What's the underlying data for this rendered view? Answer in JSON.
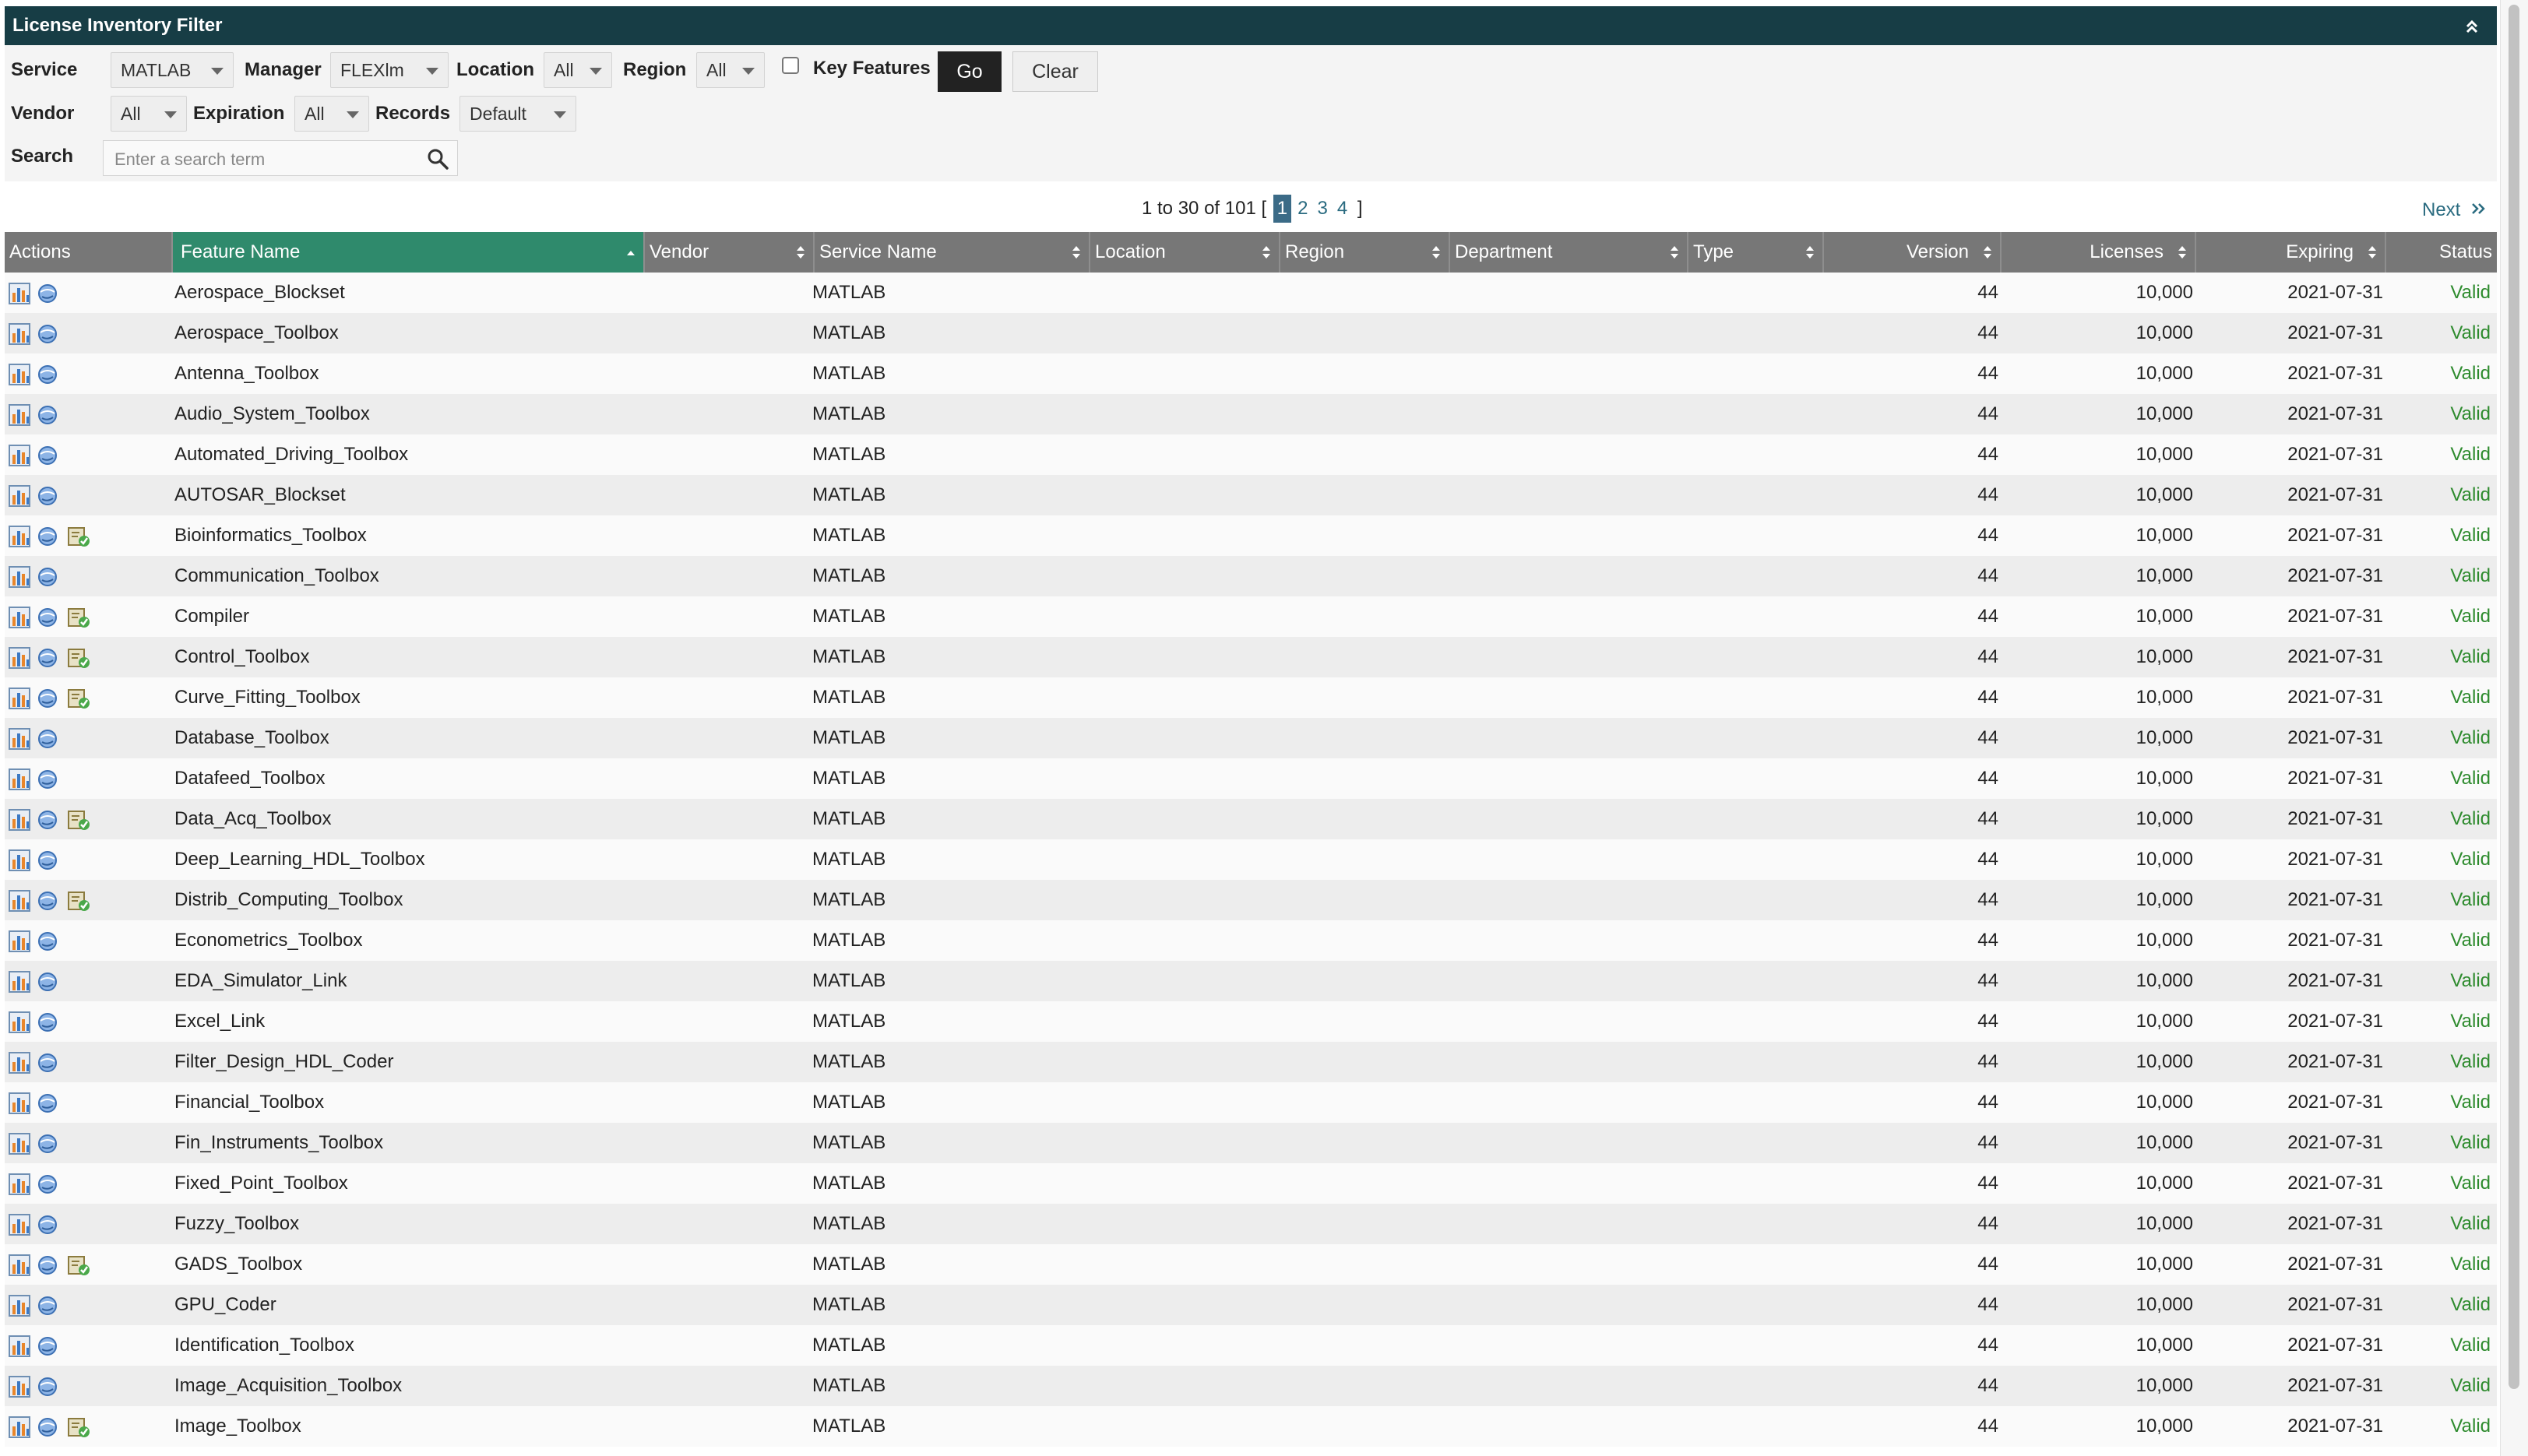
{
  "header": {
    "title": "License Inventory Filter"
  },
  "filters": {
    "service_label": "Service",
    "service_value": "MATLAB",
    "manager_label": "Manager",
    "manager_value": "FLEXlm",
    "location_label": "Location",
    "location_value": "All",
    "region_label": "Region",
    "region_value": "All",
    "key_features_label": "Key Features",
    "key_features_checked": false,
    "go_label": "Go",
    "clear_label": "Clear",
    "vendor_label": "Vendor",
    "vendor_value": "All",
    "expiration_label": "Expiration",
    "expiration_value": "All",
    "records_label": "Records",
    "records_value": "Default",
    "search_label": "Search",
    "search_placeholder": "Enter a search term"
  },
  "pagination": {
    "summary_prefix": "1 to 30 of 101 [",
    "pages": [
      "1",
      "2",
      "3",
      "4"
    ],
    "current": "1",
    "summary_suffix": "]",
    "next_label": "Next"
  },
  "table": {
    "columns": [
      "Actions",
      "Feature Name",
      "Vendor",
      "Service Name",
      "Location",
      "Region",
      "Department",
      "Type",
      "Version",
      "Licenses",
      "Expiring",
      "Status"
    ],
    "sorted_column": "Feature Name",
    "rows": [
      {
        "name": "Aerospace_Blockset",
        "service": "MATLAB",
        "version": "44",
        "licenses": "10,000",
        "expiring": "2021-07-31",
        "status": "Valid",
        "key": false
      },
      {
        "name": "Aerospace_Toolbox",
        "service": "MATLAB",
        "version": "44",
        "licenses": "10,000",
        "expiring": "2021-07-31",
        "status": "Valid",
        "key": false
      },
      {
        "name": "Antenna_Toolbox",
        "service": "MATLAB",
        "version": "44",
        "licenses": "10,000",
        "expiring": "2021-07-31",
        "status": "Valid",
        "key": false
      },
      {
        "name": "Audio_System_Toolbox",
        "service": "MATLAB",
        "version": "44",
        "licenses": "10,000",
        "expiring": "2021-07-31",
        "status": "Valid",
        "key": false
      },
      {
        "name": "Automated_Driving_Toolbox",
        "service": "MATLAB",
        "version": "44",
        "licenses": "10,000",
        "expiring": "2021-07-31",
        "status": "Valid",
        "key": false
      },
      {
        "name": "AUTOSAR_Blockset",
        "service": "MATLAB",
        "version": "44",
        "licenses": "10,000",
        "expiring": "2021-07-31",
        "status": "Valid",
        "key": false
      },
      {
        "name": "Bioinformatics_Toolbox",
        "service": "MATLAB",
        "version": "44",
        "licenses": "10,000",
        "expiring": "2021-07-31",
        "status": "Valid",
        "key": true
      },
      {
        "name": "Communication_Toolbox",
        "service": "MATLAB",
        "version": "44",
        "licenses": "10,000",
        "expiring": "2021-07-31",
        "status": "Valid",
        "key": false
      },
      {
        "name": "Compiler",
        "service": "MATLAB",
        "version": "44",
        "licenses": "10,000",
        "expiring": "2021-07-31",
        "status": "Valid",
        "key": true
      },
      {
        "name": "Control_Toolbox",
        "service": "MATLAB",
        "version": "44",
        "licenses": "10,000",
        "expiring": "2021-07-31",
        "status": "Valid",
        "key": true
      },
      {
        "name": "Curve_Fitting_Toolbox",
        "service": "MATLAB",
        "version": "44",
        "licenses": "10,000",
        "expiring": "2021-07-31",
        "status": "Valid",
        "key": true
      },
      {
        "name": "Database_Toolbox",
        "service": "MATLAB",
        "version": "44",
        "licenses": "10,000",
        "expiring": "2021-07-31",
        "status": "Valid",
        "key": false
      },
      {
        "name": "Datafeed_Toolbox",
        "service": "MATLAB",
        "version": "44",
        "licenses": "10,000",
        "expiring": "2021-07-31",
        "status": "Valid",
        "key": false
      },
      {
        "name": "Data_Acq_Toolbox",
        "service": "MATLAB",
        "version": "44",
        "licenses": "10,000",
        "expiring": "2021-07-31",
        "status": "Valid",
        "key": true
      },
      {
        "name": "Deep_Learning_HDL_Toolbox",
        "service": "MATLAB",
        "version": "44",
        "licenses": "10,000",
        "expiring": "2021-07-31",
        "status": "Valid",
        "key": false
      },
      {
        "name": "Distrib_Computing_Toolbox",
        "service": "MATLAB",
        "version": "44",
        "licenses": "10,000",
        "expiring": "2021-07-31",
        "status": "Valid",
        "key": true
      },
      {
        "name": "Econometrics_Toolbox",
        "service": "MATLAB",
        "version": "44",
        "licenses": "10,000",
        "expiring": "2021-07-31",
        "status": "Valid",
        "key": false
      },
      {
        "name": "EDA_Simulator_Link",
        "service": "MATLAB",
        "version": "44",
        "licenses": "10,000",
        "expiring": "2021-07-31",
        "status": "Valid",
        "key": false
      },
      {
        "name": "Excel_Link",
        "service": "MATLAB",
        "version": "44",
        "licenses": "10,000",
        "expiring": "2021-07-31",
        "status": "Valid",
        "key": false
      },
      {
        "name": "Filter_Design_HDL_Coder",
        "service": "MATLAB",
        "version": "44",
        "licenses": "10,000",
        "expiring": "2021-07-31",
        "status": "Valid",
        "key": false
      },
      {
        "name": "Financial_Toolbox",
        "service": "MATLAB",
        "version": "44",
        "licenses": "10,000",
        "expiring": "2021-07-31",
        "status": "Valid",
        "key": false
      },
      {
        "name": "Fin_Instruments_Toolbox",
        "service": "MATLAB",
        "version": "44",
        "licenses": "10,000",
        "expiring": "2021-07-31",
        "status": "Valid",
        "key": false
      },
      {
        "name": "Fixed_Point_Toolbox",
        "service": "MATLAB",
        "version": "44",
        "licenses": "10,000",
        "expiring": "2021-07-31",
        "status": "Valid",
        "key": false
      },
      {
        "name": "Fuzzy_Toolbox",
        "service": "MATLAB",
        "version": "44",
        "licenses": "10,000",
        "expiring": "2021-07-31",
        "status": "Valid",
        "key": false
      },
      {
        "name": "GADS_Toolbox",
        "service": "MATLAB",
        "version": "44",
        "licenses": "10,000",
        "expiring": "2021-07-31",
        "status": "Valid",
        "key": true
      },
      {
        "name": "GPU_Coder",
        "service": "MATLAB",
        "version": "44",
        "licenses": "10,000",
        "expiring": "2021-07-31",
        "status": "Valid",
        "key": false
      },
      {
        "name": "Identification_Toolbox",
        "service": "MATLAB",
        "version": "44",
        "licenses": "10,000",
        "expiring": "2021-07-31",
        "status": "Valid",
        "key": false
      },
      {
        "name": "Image_Acquisition_Toolbox",
        "service": "MATLAB",
        "version": "44",
        "licenses": "10,000",
        "expiring": "2021-07-31",
        "status": "Valid",
        "key": false
      },
      {
        "name": "Image_Toolbox",
        "service": "MATLAB",
        "version": "44",
        "licenses": "10,000",
        "expiring": "2021-07-31",
        "status": "Valid",
        "key": true
      }
    ]
  },
  "colors": {
    "header_bg": "#173d45",
    "table_header_bg": "#777777",
    "sorted_header_bg": "#2f8a6c",
    "status_valid": "#2e8b2e",
    "link": "#2a6b80"
  },
  "icons": {
    "collapse": "double-chevron-up-icon",
    "search": "magnifier-icon",
    "usage_chart": "bar-chart-icon",
    "details": "globe-icon",
    "key_feature": "checklist-icon",
    "sort": "sort-arrows-icon",
    "next": "double-chevron-right-icon"
  }
}
